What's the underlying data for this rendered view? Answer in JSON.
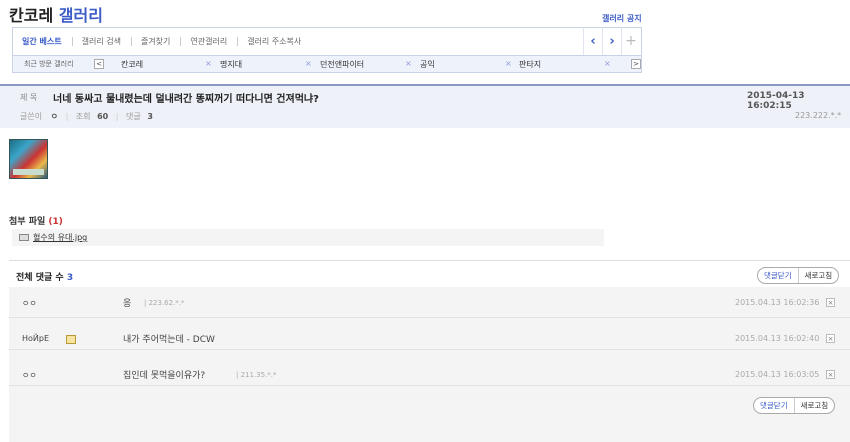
{
  "header": {
    "title_prefix": "칸코레",
    "title_accent": "갤러리",
    "notice_link": "갤러리 공지"
  },
  "nav": {
    "tabs": [
      "일간 베스트",
      "갤러리 검색",
      "즐겨찾기",
      "연관갤러리",
      "갤러리 주소복사"
    ],
    "prev_icon": "‹",
    "next_icon": "›",
    "add_icon": "+"
  },
  "recent": {
    "label": "최근 방문 갤러리",
    "prev": "<",
    "next": ">",
    "items": [
      "칸코레",
      "명지대",
      "던전앤파이터",
      "공익",
      "판타지"
    ],
    "close_mark": "×"
  },
  "post": {
    "subject_label": "제 목",
    "subject": "너네 동싸고 물내렸는데 덜내려간 똥찌꺼기 떠다니면 건져먹냐?",
    "date": "2015-04-13 16:02:15",
    "author_label": "글쓴이",
    "author": "ㅇ",
    "views_label": "조회",
    "views": "60",
    "comments_label": "댓글",
    "comments": "3",
    "ip": "223.222.*.*"
  },
  "attachment": {
    "title": "첨부 파일",
    "count": "(1)",
    "file": "혈수의 유대.jpg"
  },
  "comments": {
    "total_label": "전체 댓글 수",
    "total": "3",
    "close_label": "댓글닫기",
    "refresh_label": "새로고침",
    "items": [
      {
        "name": "ㅇㅇ",
        "text": "응",
        "ip": "| 223.62.*.*",
        "date": "2015.04.13 16:02:36"
      },
      {
        "name": "HoЙpE",
        "text": "내가 주어먹는데 - DCW",
        "ip": "",
        "date": "2015.04.13 16:02:40"
      },
      {
        "name": "ㅇㅇ",
        "text": "집인데 못먹을이유가?",
        "ip": "| 211.35.*.*",
        "date": "2015.04.13 16:03:05"
      }
    ],
    "delete_mark": "×"
  },
  "colors": {
    "accent": "#3b5bc6",
    "count_red": "#cc3333"
  }
}
